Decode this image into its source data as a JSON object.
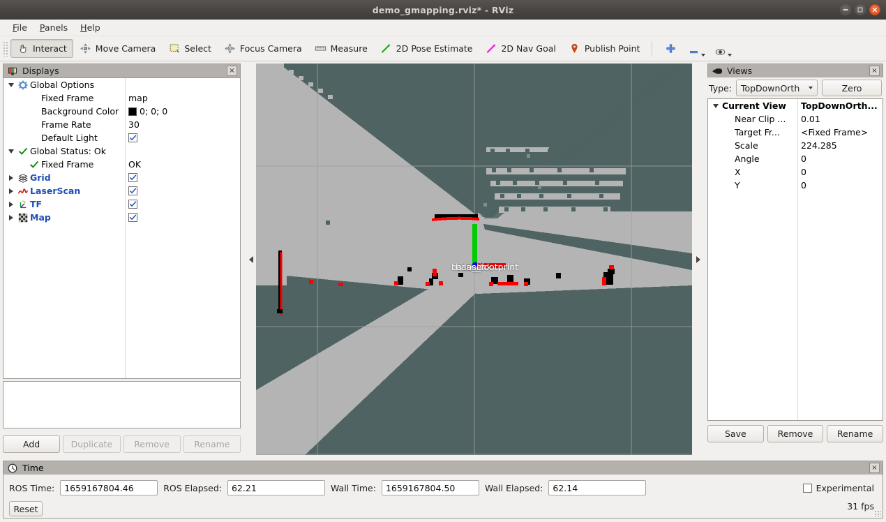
{
  "window": {
    "title": "demo_gmapping.rviz* - RViz",
    "controls": {
      "minimize": "–",
      "maximize": "",
      "close": "×"
    }
  },
  "menubar": [
    {
      "label": "File",
      "accel": "F"
    },
    {
      "label": "Panels",
      "accel": "P"
    },
    {
      "label": "Help",
      "accel": "H"
    }
  ],
  "toolbar": {
    "tools": [
      {
        "label": "Interact",
        "icon": "hand-cursor-icon",
        "active": true
      },
      {
        "label": "Move Camera",
        "icon": "move-camera-icon",
        "active": false
      },
      {
        "label": "Select",
        "icon": "select-rect-icon",
        "active": false
      },
      {
        "label": "Focus Camera",
        "icon": "focus-camera-icon",
        "active": false
      },
      {
        "label": "Measure",
        "icon": "ruler-icon",
        "active": false
      },
      {
        "label": "2D Pose Estimate",
        "icon": "green-arrow-icon",
        "active": false
      },
      {
        "label": "2D Nav Goal",
        "icon": "magenta-arrow-icon",
        "active": false
      },
      {
        "label": "Publish Point",
        "icon": "map-pin-icon",
        "active": false
      }
    ],
    "extras": [
      {
        "icon": "plus-icon"
      },
      {
        "icon": "minus-icon"
      },
      {
        "icon": "eye-icon"
      }
    ]
  },
  "displays": {
    "title": "Displays",
    "close_label": "×",
    "rows": [
      {
        "indent": 0,
        "twisty": "down",
        "icon": "gear-icon",
        "label": "Global Options",
        "label_style": "bold",
        "value": "",
        "value_type": "none"
      },
      {
        "indent": 1,
        "twisty": "none",
        "icon": "none",
        "label": "Fixed Frame",
        "label_style": "plain",
        "value": "map",
        "value_type": "text"
      },
      {
        "indent": 1,
        "twisty": "none",
        "icon": "none",
        "label": "Background Color",
        "label_style": "plain",
        "value": "0; 0; 0",
        "value_type": "color",
        "color": "#000000"
      },
      {
        "indent": 1,
        "twisty": "none",
        "icon": "none",
        "label": "Frame Rate",
        "label_style": "plain",
        "value": "30",
        "value_type": "text"
      },
      {
        "indent": 1,
        "twisty": "none",
        "icon": "none",
        "label": "Default Light",
        "label_style": "plain",
        "value": "",
        "value_type": "checkbox",
        "checked": true
      },
      {
        "indent": 0,
        "twisty": "down",
        "icon": "check-icon",
        "label": "Global Status: Ok",
        "label_style": "bold",
        "value": "",
        "value_type": "none"
      },
      {
        "indent": 1,
        "twisty": "none",
        "icon": "check-icon",
        "label": "Fixed Frame",
        "label_style": "plain",
        "value": "OK",
        "value_type": "text"
      },
      {
        "indent": 0,
        "twisty": "right",
        "icon": "grid-icon",
        "label": "Grid",
        "label_style": "blue",
        "value": "",
        "value_type": "checkbox",
        "checked": true
      },
      {
        "indent": 0,
        "twisty": "right",
        "icon": "laserscan-icon",
        "label": "LaserScan",
        "label_style": "blue",
        "value": "",
        "value_type": "checkbox",
        "checked": true
      },
      {
        "indent": 0,
        "twisty": "right",
        "icon": "tf-axes-icon",
        "label": "TF",
        "label_style": "blue",
        "value": "",
        "value_type": "checkbox",
        "checked": true
      },
      {
        "indent": 0,
        "twisty": "right",
        "icon": "map-grid-icon",
        "label": "Map",
        "label_style": "blue",
        "value": "",
        "value_type": "checkbox",
        "checked": true
      }
    ],
    "help_text": "",
    "buttons": [
      {
        "label": "Add",
        "enabled": true
      },
      {
        "label": "Duplicate",
        "enabled": false
      },
      {
        "label": "Remove",
        "enabled": false
      },
      {
        "label": "Rename",
        "enabled": false
      }
    ]
  },
  "views": {
    "title": "Views",
    "close_label": "×",
    "type_label": "Type:",
    "type_value": "TopDownOrth",
    "zero_label": "Zero",
    "rows": [
      {
        "indent": 0,
        "twisty": "down",
        "label": "Current View",
        "label_style": "bold",
        "value": "TopDownOrth...",
        "value_style": "bold"
      },
      {
        "indent": 1,
        "twisty": "none",
        "label": "Near Clip ...",
        "label_style": "plain",
        "value": "0.01",
        "value_style": "plain"
      },
      {
        "indent": 1,
        "twisty": "none",
        "label": "Target Fr...",
        "label_style": "plain",
        "value": "<Fixed Frame>",
        "value_style": "plain"
      },
      {
        "indent": 1,
        "twisty": "none",
        "label": "Scale",
        "label_style": "plain",
        "value": "224.285",
        "value_style": "plain"
      },
      {
        "indent": 1,
        "twisty": "none",
        "label": "Angle",
        "label_style": "plain",
        "value": "0",
        "value_style": "plain"
      },
      {
        "indent": 1,
        "twisty": "none",
        "label": "X",
        "label_style": "plain",
        "value": "0",
        "value_style": "plain"
      },
      {
        "indent": 1,
        "twisty": "none",
        "label": "Y",
        "label_style": "plain",
        "value": "0",
        "value_style": "plain"
      }
    ],
    "buttons": [
      {
        "label": "Save"
      },
      {
        "label": "Remove"
      },
      {
        "label": "Rename"
      }
    ]
  },
  "viewport": {
    "tf_labels": [
      "base_link",
      "base_footprint",
      "laser"
    ],
    "colors": {
      "free_space": "#b4b4b4",
      "unknown": "#4e6362",
      "occupied": "#000000",
      "laser_points": "#ff0000",
      "axis_x": "#ff0000",
      "axis_y": "#00cc00",
      "axis_z": "#0000ff",
      "grid_line": "#9f9f9f"
    },
    "splitter_left_icon": "collapse-left-icon",
    "splitter_right_icon": "collapse-right-icon"
  },
  "time": {
    "title": "Time",
    "close_label": "×",
    "fields": [
      {
        "label": "ROS Time:",
        "value": "1659167804.46"
      },
      {
        "label": "ROS Elapsed:",
        "value": "62.21"
      },
      {
        "label": "Wall Time:",
        "value": "1659167804.50"
      },
      {
        "label": "Wall Elapsed:",
        "value": "62.14"
      }
    ],
    "reset_label": "Reset",
    "experimental_label": "Experimental",
    "experimental_checked": false,
    "fps": "31 fps"
  }
}
